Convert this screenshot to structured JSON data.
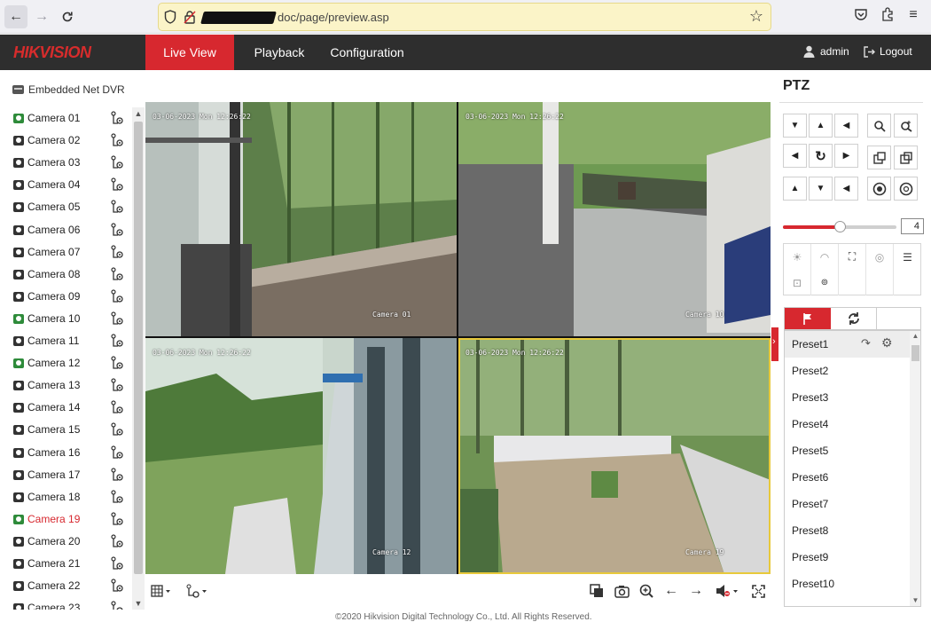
{
  "browser": {
    "url_text": "doc/page/preview.asp"
  },
  "header": {
    "logo": "HIKVISION",
    "tabs": [
      {
        "label": "Live View",
        "active": true
      },
      {
        "label": "Playback",
        "active": false
      },
      {
        "label": "Configuration",
        "active": false
      }
    ],
    "user": "admin",
    "logout": "Logout"
  },
  "device_tree": {
    "title": "Embedded Net DVR",
    "cameras": [
      {
        "label": "Camera 01",
        "recording": true
      },
      {
        "label": "Camera 02",
        "recording": false
      },
      {
        "label": "Camera 03",
        "recording": false
      },
      {
        "label": "Camera 04",
        "recording": false
      },
      {
        "label": "Camera 05",
        "recording": false
      },
      {
        "label": "Camera 06",
        "recording": false
      },
      {
        "label": "Camera 07",
        "recording": false
      },
      {
        "label": "Camera 08",
        "recording": false
      },
      {
        "label": "Camera 09",
        "recording": false
      },
      {
        "label": "Camera 10",
        "recording": true
      },
      {
        "label": "Camera 11",
        "recording": false
      },
      {
        "label": "Camera 12",
        "recording": true
      },
      {
        "label": "Camera 13",
        "recording": false
      },
      {
        "label": "Camera 14",
        "recording": false
      },
      {
        "label": "Camera 15",
        "recording": false
      },
      {
        "label": "Camera 16",
        "recording": false
      },
      {
        "label": "Camera 17",
        "recording": false
      },
      {
        "label": "Camera 18",
        "recording": false
      },
      {
        "label": "Camera 19",
        "recording": true,
        "active": true
      },
      {
        "label": "Camera 20",
        "recording": false
      },
      {
        "label": "Camera 21",
        "recording": false
      },
      {
        "label": "Camera 22",
        "recording": false
      },
      {
        "label": "Camera 23",
        "recording": false
      }
    ]
  },
  "video": {
    "tiles": [
      {
        "timestamp": "03-06-2023 Mon 12:26:22",
        "name": "Camera 01",
        "selected": false
      },
      {
        "timestamp": "03-06-2023 Mon 12:26:22",
        "name": "Camera 10",
        "selected": false
      },
      {
        "timestamp": "03-06-2023 Mon 12:26:22",
        "name": "Camera 12",
        "selected": false
      },
      {
        "timestamp": "03-06-2023 Mon 12:26:22",
        "name": "Camera 19",
        "selected": true
      }
    ]
  },
  "footer": "©2020 Hikvision Digital Technology Co., Ltd. All Rights Reserved.",
  "ptz": {
    "title": "PTZ",
    "speed": 4,
    "speed_max": 7,
    "presets": [
      "Preset1",
      "Preset2",
      "Preset3",
      "Preset4",
      "Preset5",
      "Preset6",
      "Preset7",
      "Preset8",
      "Preset9",
      "Preset10"
    ]
  },
  "colors": {
    "accent": "#d7282f",
    "header_bg": "#2e2e2e",
    "selected_tile": "#e8c93b"
  }
}
